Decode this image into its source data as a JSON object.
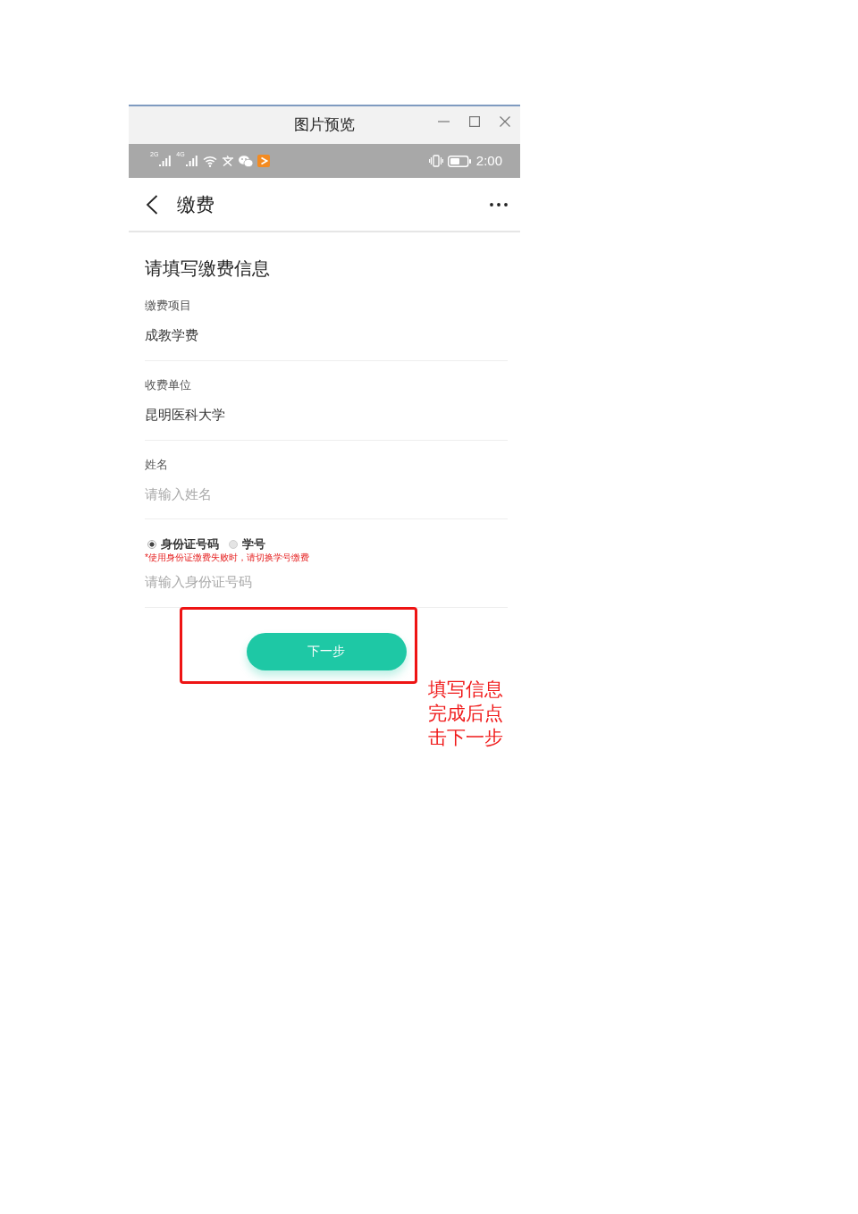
{
  "window": {
    "title": "图片预览"
  },
  "status_bar": {
    "networks": [
      {
        "label": "2G"
      },
      {
        "label": "4G"
      }
    ],
    "time": "2:00"
  },
  "app_bar": {
    "title": "缴费"
  },
  "form": {
    "heading": "请填写缴费信息",
    "fields": [
      {
        "kind": "display",
        "label": "缴费项目",
        "value": "成教学费"
      },
      {
        "kind": "display",
        "label": "收费单位",
        "value": "昆明医科大学"
      },
      {
        "kind": "input",
        "label": "姓名",
        "placeholder": "请输入姓名"
      },
      {
        "kind": "choice",
        "options": [
          {
            "label": "身份证号码",
            "selected": true
          },
          {
            "label": "学号",
            "selected": false
          }
        ],
        "note": "*使用身份证缴费失败时，请切换学号缴费",
        "placeholder": "请输入身份证号码"
      }
    ],
    "submit": "下一步"
  },
  "callout": {
    "text": "填写信息完成后点击下一步"
  }
}
